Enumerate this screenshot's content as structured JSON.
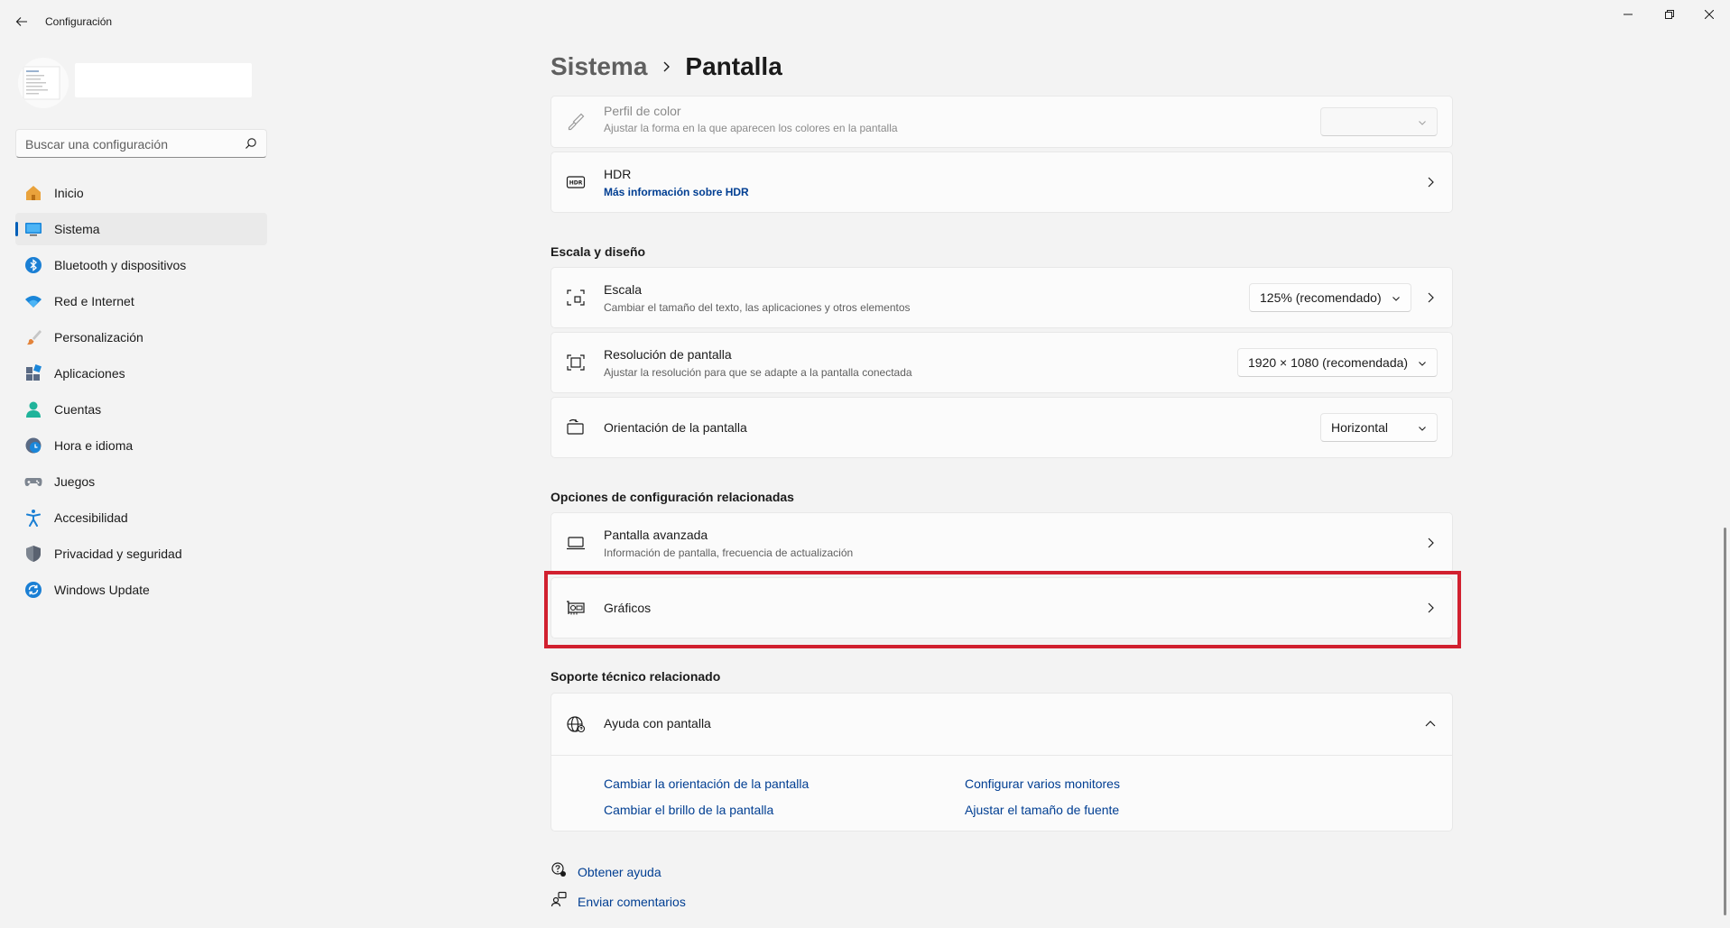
{
  "window": {
    "title": "Configuración"
  },
  "sidebar": {
    "search_placeholder": "Buscar una configuración",
    "items": [
      {
        "label": "Inicio",
        "icon": "home-icon",
        "active": false
      },
      {
        "label": "Sistema",
        "icon": "system-icon",
        "active": true
      },
      {
        "label": "Bluetooth y dispositivos",
        "icon": "bluetooth-icon",
        "active": false
      },
      {
        "label": "Red e Internet",
        "icon": "wifi-icon",
        "active": false
      },
      {
        "label": "Personalización",
        "icon": "brush-icon",
        "active": false
      },
      {
        "label": "Aplicaciones",
        "icon": "apps-icon",
        "active": false
      },
      {
        "label": "Cuentas",
        "icon": "account-icon",
        "active": false
      },
      {
        "label": "Hora e idioma",
        "icon": "clock-globe-icon",
        "active": false
      },
      {
        "label": "Juegos",
        "icon": "gamepad-icon",
        "active": false
      },
      {
        "label": "Accesibilidad",
        "icon": "accessibility-icon",
        "active": false
      },
      {
        "label": "Privacidad y seguridad",
        "icon": "shield-icon",
        "active": false
      },
      {
        "label": "Windows Update",
        "icon": "update-icon",
        "active": false
      }
    ]
  },
  "breadcrumb": {
    "parent": "Sistema",
    "current": "Pantalla"
  },
  "cards": {
    "color_profile": {
      "title": "Perfil de color",
      "subtitle": "Ajustar la forma en la que aparecen los colores en la pantalla",
      "value": ""
    },
    "hdr": {
      "title": "HDR",
      "link": "Más información sobre HDR"
    },
    "scale": {
      "title": "Escala",
      "subtitle": "Cambiar el tamaño del texto, las aplicaciones y otros elementos",
      "value": "125% (recomendado)"
    },
    "resolution": {
      "title": "Resolución de pantalla",
      "subtitle": "Ajustar la resolución para que se adapte a la pantalla conectada",
      "value": "1920 × 1080 (recomendada)"
    },
    "orientation": {
      "title": "Orientación de la pantalla",
      "value": "Horizontal"
    },
    "advanced": {
      "title": "Pantalla avanzada",
      "subtitle": "Información de pantalla, frecuencia de actualización"
    },
    "graphics": {
      "title": "Gráficos"
    },
    "help": {
      "title": "Ayuda con pantalla"
    }
  },
  "sections": {
    "scale_layout": "Escala y diseño",
    "related": "Opciones de configuración relacionadas",
    "support": "Soporte técnico relacionado"
  },
  "help_links": [
    "Cambiar la orientación de la pantalla",
    "Configurar varios monitores",
    "Cambiar el brillo de la pantalla",
    "Ajustar el tamaño de fuente"
  ],
  "footer": {
    "get_help": "Obtener ayuda",
    "feedback": "Enviar comentarios"
  },
  "colors": {
    "accent": "#005fb8",
    "link": "#003e92",
    "highlight": "#d1202f"
  }
}
